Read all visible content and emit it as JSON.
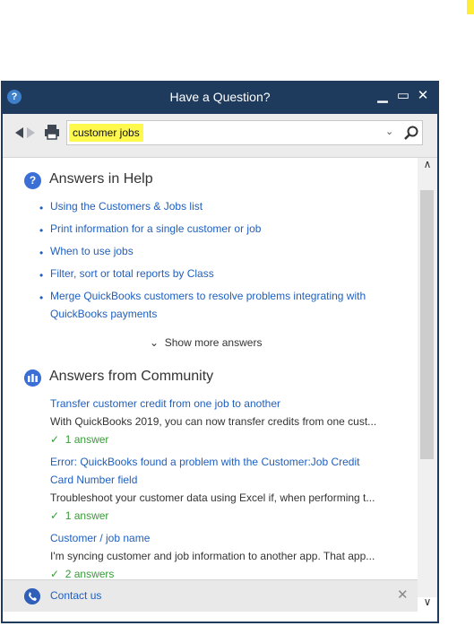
{
  "window": {
    "title": "Have a Question?"
  },
  "search": {
    "value": "customer jobs"
  },
  "help": {
    "heading": "Answers in Help",
    "links": [
      "Using the Customers & Jobs list",
      "Print information for a single customer or job",
      "When to use jobs",
      "Filter, sort or total reports by Class",
      "Merge QuickBooks customers to resolve problems integrating with QuickBooks payments"
    ],
    "show_more": "Show more answers"
  },
  "community": {
    "heading": "Answers from Community",
    "items": [
      {
        "title": "Transfer customer credit from one job to another",
        "snippet": "With QuickBooks 2019, you can now transfer credits from one cust...",
        "answers": "1 answer"
      },
      {
        "title": "Error: QuickBooks found a problem with the Customer:Job Credit Card Number field",
        "snippet": "Troubleshoot your customer data using Excel if, when performing t...",
        "answers": "1 answer"
      },
      {
        "title": "Customer / job name",
        "snippet": "I'm syncing customer and job information to another app. That app...",
        "answers": "2 answers"
      }
    ]
  },
  "footer": {
    "contact": "Contact us"
  },
  "icons": {
    "help": "help-icon",
    "back": "back-arrow-icon",
    "forward": "forward-arrow-icon",
    "print": "print-icon",
    "search": "search-icon",
    "phone": "phone-icon",
    "community": "community-icon",
    "close": "close-icon"
  },
  "colors": {
    "titlebar": "#1e3a5c",
    "link": "#1f5fbf",
    "highlight": "#fff94d",
    "answer_green": "#3a9a3a"
  }
}
